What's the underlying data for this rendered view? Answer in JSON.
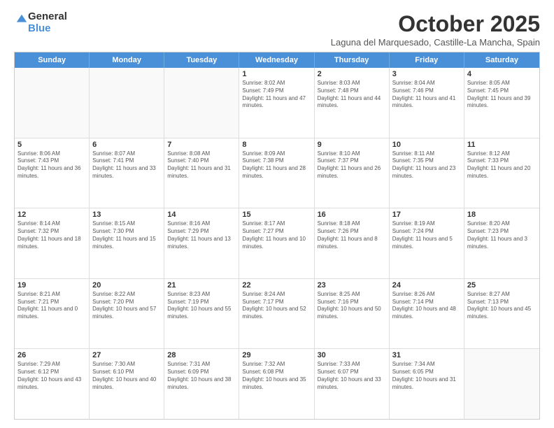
{
  "logo": {
    "general": "General",
    "blue": "Blue"
  },
  "title": "October 2025",
  "location": "Laguna del Marquesado, Castille-La Mancha, Spain",
  "header_days": [
    "Sunday",
    "Monday",
    "Tuesday",
    "Wednesday",
    "Thursday",
    "Friday",
    "Saturday"
  ],
  "rows": [
    [
      {
        "day": "",
        "info": ""
      },
      {
        "day": "",
        "info": ""
      },
      {
        "day": "",
        "info": ""
      },
      {
        "day": "1",
        "info": "Sunrise: 8:02 AM\nSunset: 7:49 PM\nDaylight: 11 hours and 47 minutes."
      },
      {
        "day": "2",
        "info": "Sunrise: 8:03 AM\nSunset: 7:48 PM\nDaylight: 11 hours and 44 minutes."
      },
      {
        "day": "3",
        "info": "Sunrise: 8:04 AM\nSunset: 7:46 PM\nDaylight: 11 hours and 41 minutes."
      },
      {
        "day": "4",
        "info": "Sunrise: 8:05 AM\nSunset: 7:45 PM\nDaylight: 11 hours and 39 minutes."
      }
    ],
    [
      {
        "day": "5",
        "info": "Sunrise: 8:06 AM\nSunset: 7:43 PM\nDaylight: 11 hours and 36 minutes."
      },
      {
        "day": "6",
        "info": "Sunrise: 8:07 AM\nSunset: 7:41 PM\nDaylight: 11 hours and 33 minutes."
      },
      {
        "day": "7",
        "info": "Sunrise: 8:08 AM\nSunset: 7:40 PM\nDaylight: 11 hours and 31 minutes."
      },
      {
        "day": "8",
        "info": "Sunrise: 8:09 AM\nSunset: 7:38 PM\nDaylight: 11 hours and 28 minutes."
      },
      {
        "day": "9",
        "info": "Sunrise: 8:10 AM\nSunset: 7:37 PM\nDaylight: 11 hours and 26 minutes."
      },
      {
        "day": "10",
        "info": "Sunrise: 8:11 AM\nSunset: 7:35 PM\nDaylight: 11 hours and 23 minutes."
      },
      {
        "day": "11",
        "info": "Sunrise: 8:12 AM\nSunset: 7:33 PM\nDaylight: 11 hours and 20 minutes."
      }
    ],
    [
      {
        "day": "12",
        "info": "Sunrise: 8:14 AM\nSunset: 7:32 PM\nDaylight: 11 hours and 18 minutes."
      },
      {
        "day": "13",
        "info": "Sunrise: 8:15 AM\nSunset: 7:30 PM\nDaylight: 11 hours and 15 minutes."
      },
      {
        "day": "14",
        "info": "Sunrise: 8:16 AM\nSunset: 7:29 PM\nDaylight: 11 hours and 13 minutes."
      },
      {
        "day": "15",
        "info": "Sunrise: 8:17 AM\nSunset: 7:27 PM\nDaylight: 11 hours and 10 minutes."
      },
      {
        "day": "16",
        "info": "Sunrise: 8:18 AM\nSunset: 7:26 PM\nDaylight: 11 hours and 8 minutes."
      },
      {
        "day": "17",
        "info": "Sunrise: 8:19 AM\nSunset: 7:24 PM\nDaylight: 11 hours and 5 minutes."
      },
      {
        "day": "18",
        "info": "Sunrise: 8:20 AM\nSunset: 7:23 PM\nDaylight: 11 hours and 3 minutes."
      }
    ],
    [
      {
        "day": "19",
        "info": "Sunrise: 8:21 AM\nSunset: 7:21 PM\nDaylight: 11 hours and 0 minutes."
      },
      {
        "day": "20",
        "info": "Sunrise: 8:22 AM\nSunset: 7:20 PM\nDaylight: 10 hours and 57 minutes."
      },
      {
        "day": "21",
        "info": "Sunrise: 8:23 AM\nSunset: 7:19 PM\nDaylight: 10 hours and 55 minutes."
      },
      {
        "day": "22",
        "info": "Sunrise: 8:24 AM\nSunset: 7:17 PM\nDaylight: 10 hours and 52 minutes."
      },
      {
        "day": "23",
        "info": "Sunrise: 8:25 AM\nSunset: 7:16 PM\nDaylight: 10 hours and 50 minutes."
      },
      {
        "day": "24",
        "info": "Sunrise: 8:26 AM\nSunset: 7:14 PM\nDaylight: 10 hours and 48 minutes."
      },
      {
        "day": "25",
        "info": "Sunrise: 8:27 AM\nSunset: 7:13 PM\nDaylight: 10 hours and 45 minutes."
      }
    ],
    [
      {
        "day": "26",
        "info": "Sunrise: 7:29 AM\nSunset: 6:12 PM\nDaylight: 10 hours and 43 minutes."
      },
      {
        "day": "27",
        "info": "Sunrise: 7:30 AM\nSunset: 6:10 PM\nDaylight: 10 hours and 40 minutes."
      },
      {
        "day": "28",
        "info": "Sunrise: 7:31 AM\nSunset: 6:09 PM\nDaylight: 10 hours and 38 minutes."
      },
      {
        "day": "29",
        "info": "Sunrise: 7:32 AM\nSunset: 6:08 PM\nDaylight: 10 hours and 35 minutes."
      },
      {
        "day": "30",
        "info": "Sunrise: 7:33 AM\nSunset: 6:07 PM\nDaylight: 10 hours and 33 minutes."
      },
      {
        "day": "31",
        "info": "Sunrise: 7:34 AM\nSunset: 6:05 PM\nDaylight: 10 hours and 31 minutes."
      },
      {
        "day": "",
        "info": ""
      }
    ]
  ]
}
